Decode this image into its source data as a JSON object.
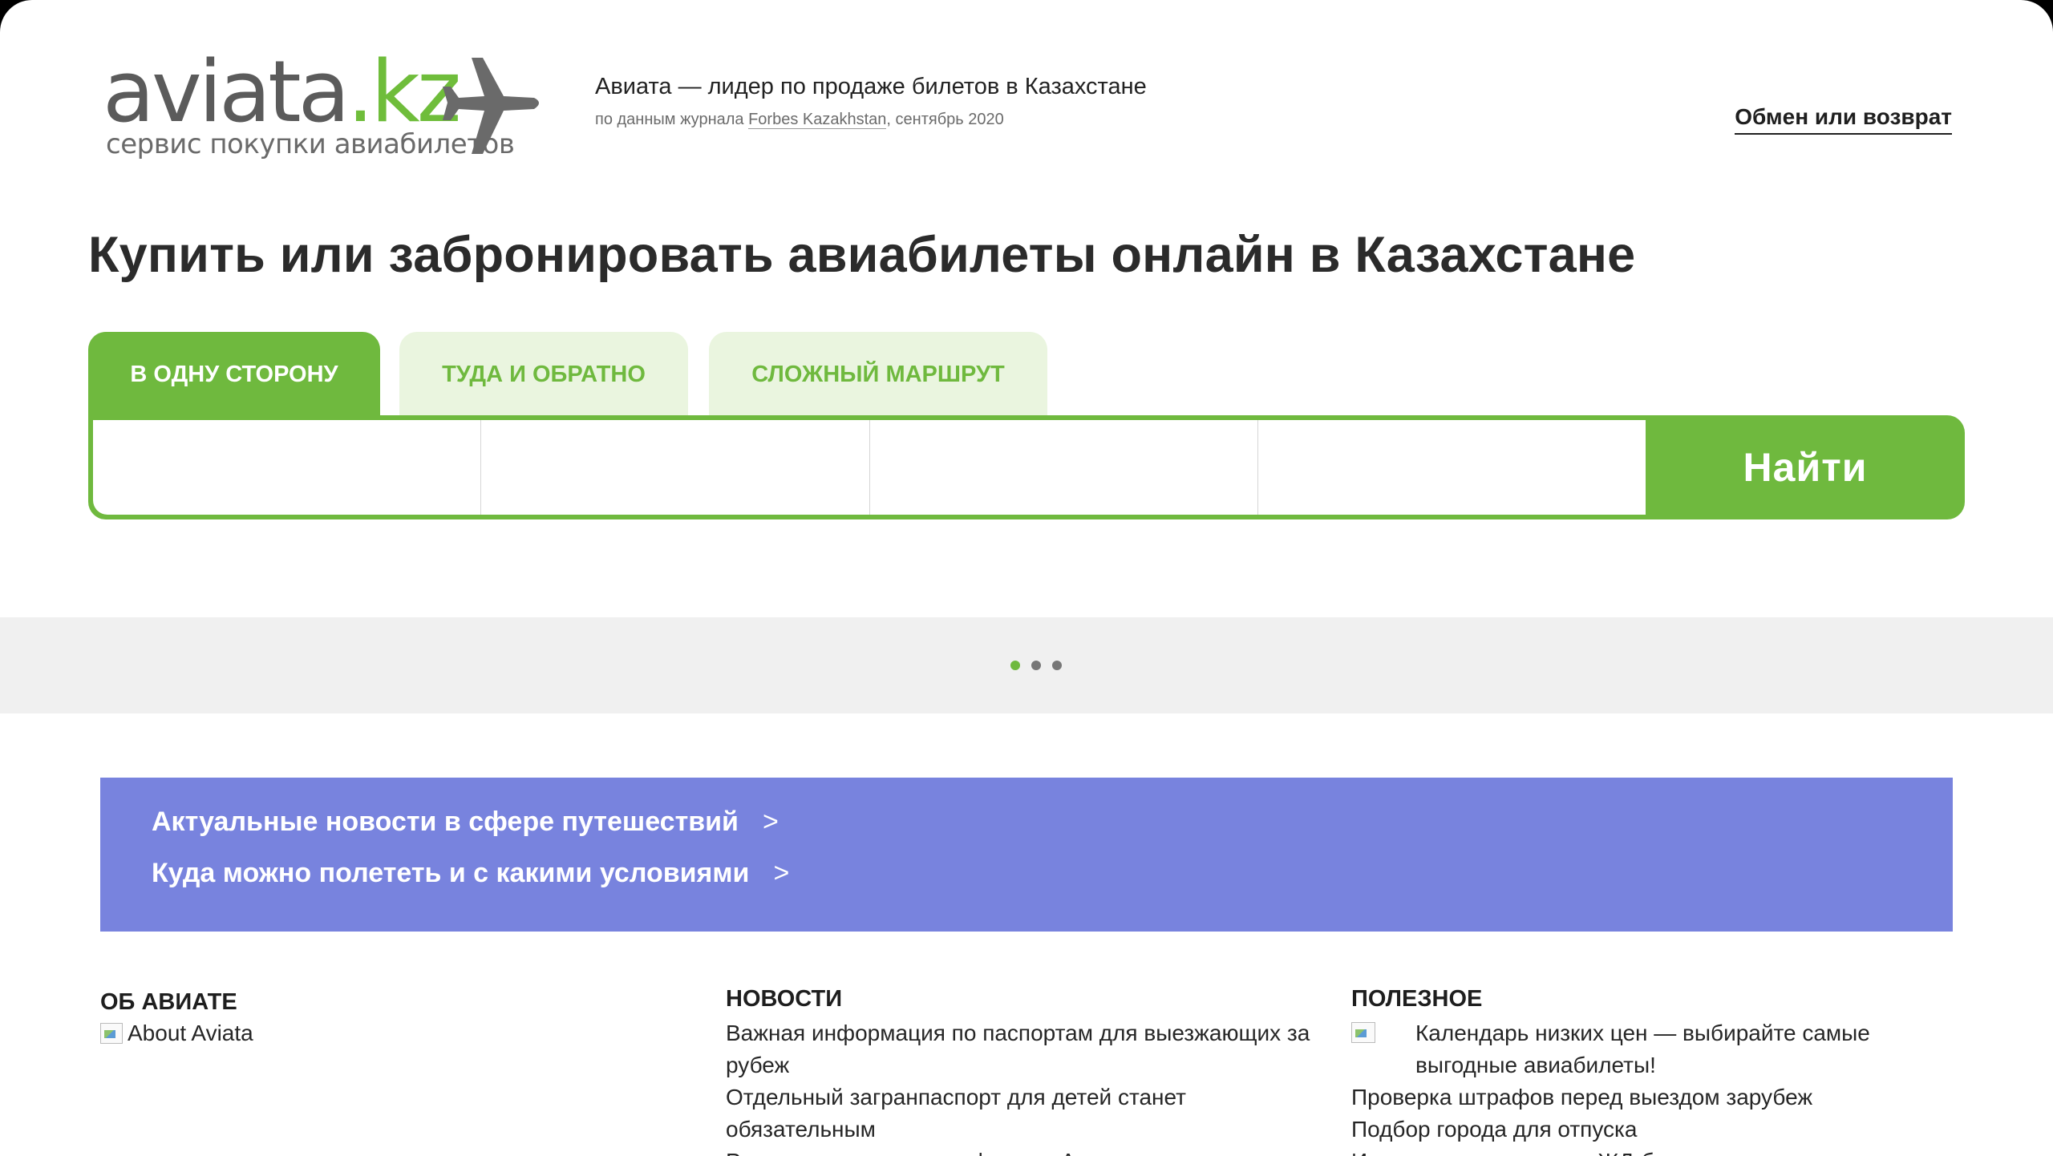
{
  "header": {
    "logo_main": "aviata",
    "logo_domain": ".kz",
    "logo_tagline": "сервис покупки авиабилетов",
    "slogan": "Авиата — лидер по продаже билетов в Казахстане",
    "slogan_sub_before": "по данным журнала ",
    "slogan_sub_link": "Forbes Kazakhstan",
    "slogan_sub_after": ", сентябрь 2020",
    "exchange_link": "Обмен или возврат"
  },
  "page_title": "Купить или забронировать авиабилеты онлайн в Казахстане",
  "tabs": [
    {
      "label": "В одну сторону",
      "active": true
    },
    {
      "label": "Туда и обратно",
      "active": false
    },
    {
      "label": "Сложный маршрут",
      "active": false
    }
  ],
  "search": {
    "from_value": "",
    "to_value": "",
    "date_value": "",
    "passengers_value": "",
    "find_label": "Найти"
  },
  "carousel": {
    "dots": 3,
    "active_index": 0
  },
  "banner": {
    "links": [
      {
        "label": "Актуальные новости в сфере путешествий",
        "arrow": ">"
      },
      {
        "label": "Куда можно полететь и с какими условиями",
        "arrow": ">"
      }
    ]
  },
  "footer": {
    "about": {
      "title": "Об Авиате",
      "image_alt": "About Aviata"
    },
    "news": {
      "title": "Новости",
      "items": [
        "Важная информация по паспортам для выезжающих за рубеж",
        "Отдельный загранпаспорт для детей станет обязательным",
        "Рассказываем о новых фишках Авиаты в"
      ]
    },
    "useful": {
      "title": "Полезное",
      "items": [
        "Календарь низких цен — выбирайте самые выгодные авиабилеты!",
        "Проверка штрафов перед выездом зарубеж",
        "Подбор города для отпуска",
        "Инструкция: как купить ЖД-билет"
      ]
    }
  },
  "colors": {
    "brand_green": "#6fb93e",
    "tab_inactive_bg": "#eaf5df",
    "banner_purple": "#7883de",
    "strip_gray": "#f0f0f0"
  },
  "icons": {
    "logo": "airplane-icon"
  }
}
